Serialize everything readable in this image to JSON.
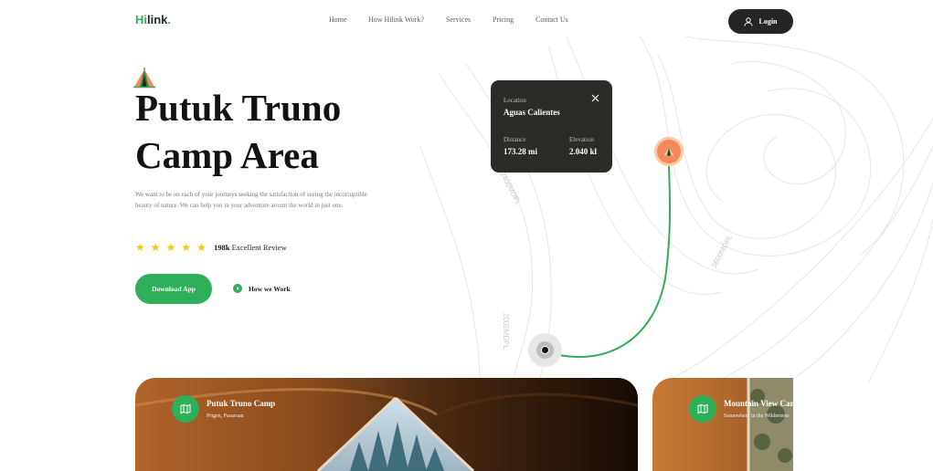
{
  "nav": {
    "logo_main": "Hilink",
    "logo_dot": ".",
    "links": [
      "Home",
      "How Hilink Work?",
      "Services",
      "Pricing",
      "Contact Us"
    ],
    "login_label": "Login"
  },
  "hero": {
    "title_line1": "Putuk Truno",
    "title_line2": "Camp Area",
    "description": "We want to be on each of your journeys seeking the satisfaction of seeing the incorruptible beauty of nature. We can help you in your adventure arount the world in just one.",
    "stars": 5,
    "review_count": "198k",
    "review_text": " Excellent Review",
    "download_label": "Download App",
    "how_label": "How we Work"
  },
  "location_card": {
    "location_label": "Location",
    "location_value": "Aguas Calientes",
    "distance_label": "Distance",
    "distance_value": "173.28 mi",
    "elevation_label": "Elevation",
    "elevation_value": "2.040 kl"
  },
  "map_labels": [
    "2400MDPL",
    "3600MDPL",
    "2000MDPL"
  ],
  "cards": [
    {
      "title": "Putuk Truno Camp",
      "subtitle": "Prigen, Pasuruan"
    },
    {
      "title": "Mountain View Camp",
      "subtitle": "Somewhere in the Wilderness"
    }
  ],
  "colors": {
    "accent": "#30af5b",
    "dark": "#292c27",
    "star": "#fec601",
    "pin": "#f48a5b"
  }
}
